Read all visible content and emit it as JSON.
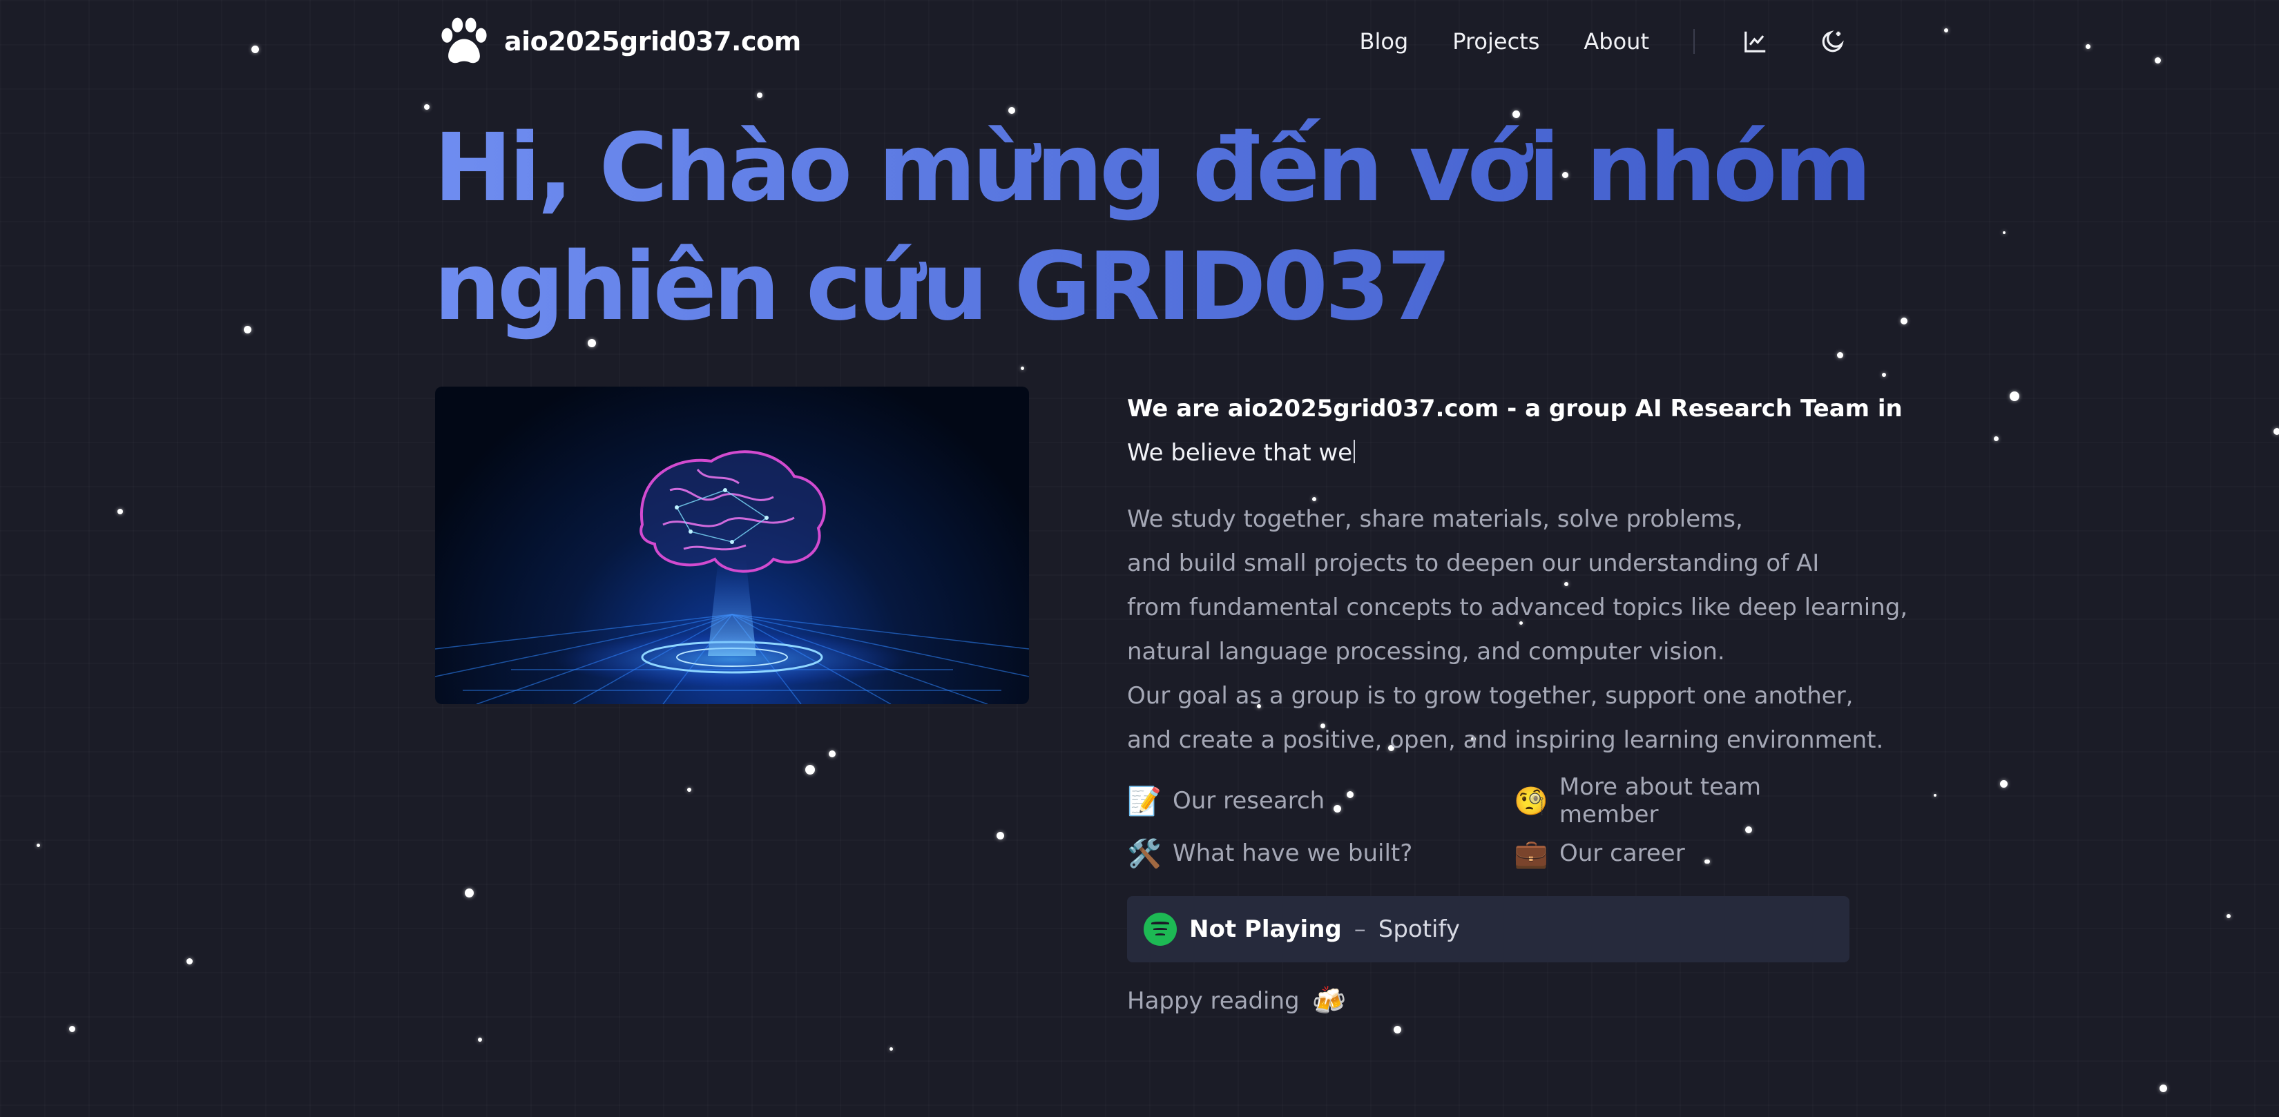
{
  "site": {
    "name": "aio2025grid037.com",
    "logo_icon": "paw-icon"
  },
  "nav": {
    "items": [
      {
        "label": "Blog"
      },
      {
        "label": "Projects"
      },
      {
        "label": "About"
      }
    ],
    "analytics_icon": "chart-icon",
    "theme_icon": "moon-sparkle-icon"
  },
  "hero": {
    "title_line1": "Hi, Chào mừng đến với nhóm",
    "title_line2": "nghiên cứu GRID037",
    "image": "ai-brain-hologram"
  },
  "intro": {
    "line1": "We are aio2025grid037.com - a group AI Research Team in",
    "line2": "We believe that we"
  },
  "description": {
    "lines": [
      "We study together, share materials, solve problems,",
      "and build small projects to deepen our understanding of AI",
      "from fundamental concepts to advanced topics like deep learning,",
      "natural language processing, and computer vision.",
      "Our goal as a group is to grow together, support one another,",
      "and create a positive, open, and inspiring learning environment."
    ]
  },
  "links": [
    {
      "emoji": "📝",
      "label": "Our research",
      "icon": "memo-icon"
    },
    {
      "emoji": "🧐",
      "label": "More about team member",
      "icon": "monocle-face-icon"
    },
    {
      "emoji": "🛠️",
      "label": "What have we built?",
      "icon": "tools-icon"
    },
    {
      "emoji": "💼",
      "label": "Our career",
      "icon": "briefcase-icon"
    }
  ],
  "spotify": {
    "status": "Not Playing",
    "separator": "–",
    "name": "Spotify",
    "icon": "spotify-icon"
  },
  "footer": {
    "text": "Happy reading",
    "emoji": "🍻",
    "icon": "beer-mugs-icon"
  },
  "colors": {
    "background": "#1b1c27",
    "title_gradient_start": "#6f8df0",
    "title_gradient_end": "#3f5bc9",
    "muted_text": "#a5a8b6",
    "spotify_green": "#1db954"
  }
}
